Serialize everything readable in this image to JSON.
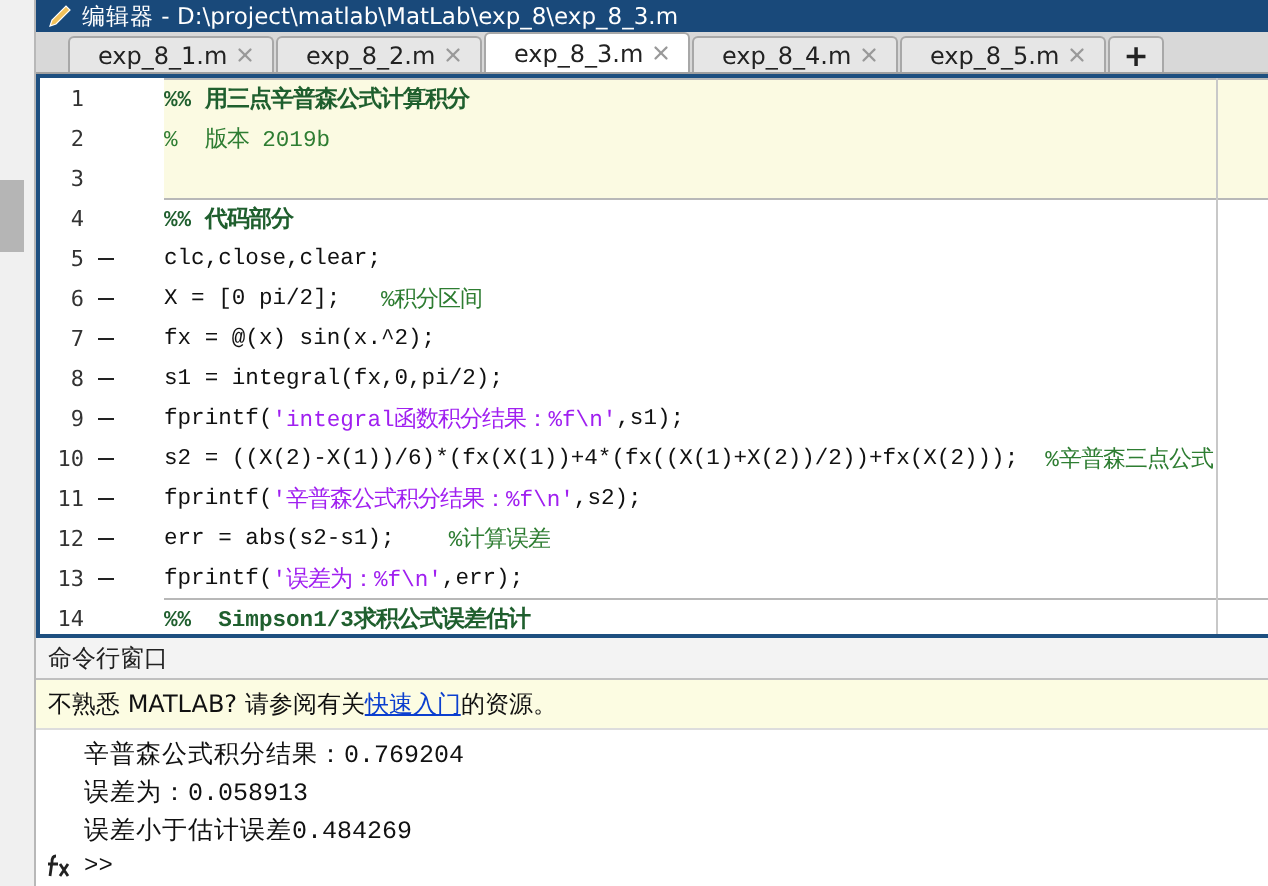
{
  "window": {
    "title": "编辑器 - D:\\project\\matlab\\MatLab\\exp_8\\exp_8_3.m"
  },
  "tabs": [
    {
      "label": "exp_8_1.m",
      "selected": false
    },
    {
      "label": "exp_8_2.m",
      "selected": false
    },
    {
      "label": "exp_8_3.m",
      "selected": true
    },
    {
      "label": "exp_8_4.m",
      "selected": false
    },
    {
      "label": "exp_8_5.m",
      "selected": false
    }
  ],
  "new_tab": "+",
  "editor": {
    "lines": [
      {
        "number": "1",
        "executable": false,
        "active_section": true,
        "section_start": true,
        "segments": [
          {
            "kind": "section",
            "text": "%% 用三点辛普森公式计算积分"
          }
        ]
      },
      {
        "number": "2",
        "executable": false,
        "active_section": true,
        "section_start": false,
        "segments": [
          {
            "kind": "comment",
            "text": "%  版本 2019b"
          }
        ]
      },
      {
        "number": "3",
        "executable": false,
        "active_section": true,
        "section_start": false
      },
      {
        "number": "4",
        "executable": false,
        "active_section": false,
        "section_start": true,
        "segments": [
          {
            "kind": "section",
            "text": "%% 代码部分"
          }
        ]
      },
      {
        "number": "5",
        "executable": true,
        "active_section": false,
        "section_start": false,
        "segments": [
          {
            "kind": "code",
            "text": "clc,close,clear;"
          }
        ]
      },
      {
        "number": "6",
        "executable": true,
        "active_section": false,
        "section_start": false,
        "segments": [
          {
            "kind": "code",
            "text": "X = [0 pi/2];   "
          },
          {
            "kind": "comment",
            "text": "%积分区间"
          }
        ]
      },
      {
        "number": "7",
        "executable": true,
        "active_section": false,
        "section_start": false,
        "segments": [
          {
            "kind": "code",
            "text": "fx = @(x) sin(x.^2);"
          }
        ]
      },
      {
        "number": "8",
        "executable": true,
        "active_section": false,
        "section_start": false,
        "segments": [
          {
            "kind": "code",
            "text": "s1 = integral(fx,0,pi/2);"
          }
        ]
      },
      {
        "number": "9",
        "executable": true,
        "active_section": false,
        "section_start": false,
        "segments": [
          {
            "kind": "code",
            "text": "fprintf("
          },
          {
            "kind": "string",
            "text": "'integral函数积分结果：%f\\n'"
          },
          {
            "kind": "code",
            "text": ",s1);"
          }
        ]
      },
      {
        "number": "10",
        "executable": true,
        "active_section": false,
        "section_start": false,
        "segments": [
          {
            "kind": "code",
            "text": "s2 = ((X(2)-X(1))/6)*(fx(X(1))+4*(fx((X(1)+X(2))/2))+fx(X(2)));  "
          },
          {
            "kind": "comment",
            "text": "%辛普森三点公式"
          }
        ]
      },
      {
        "number": "11",
        "executable": true,
        "active_section": false,
        "section_start": false,
        "segments": [
          {
            "kind": "code",
            "text": "fprintf("
          },
          {
            "kind": "string",
            "text": "'辛普森公式积分结果：%f\\n'"
          },
          {
            "kind": "code",
            "text": ",s2);"
          }
        ]
      },
      {
        "number": "12",
        "executable": true,
        "active_section": false,
        "section_start": false,
        "segments": [
          {
            "kind": "code",
            "text": "err = abs(s2-s1);    "
          },
          {
            "kind": "comment",
            "text": "%计算误差"
          }
        ]
      },
      {
        "number": "13",
        "executable": true,
        "active_section": false,
        "section_start": false,
        "segments": [
          {
            "kind": "code",
            "text": "fprintf("
          },
          {
            "kind": "string",
            "text": "'误差为：%f\\n'"
          },
          {
            "kind": "code",
            "text": ",err);"
          }
        ]
      },
      {
        "number": "14",
        "executable": false,
        "active_section": false,
        "section_start": true,
        "segments": [
          {
            "kind": "section",
            "text": "%%  Simpson1/3求积公式误差估计"
          }
        ]
      }
    ]
  },
  "command_window": {
    "title": "命令行窗口",
    "notice": {
      "before": "不熟悉 MATLAB? 请参阅有关",
      "link": "快速入门",
      "after": "的资源。"
    },
    "output": [
      "辛普森公式积分结果：0.769204",
      "误差为：0.058913",
      "误差小于估计误差0.484269"
    ],
    "prompt": ">>"
  }
}
